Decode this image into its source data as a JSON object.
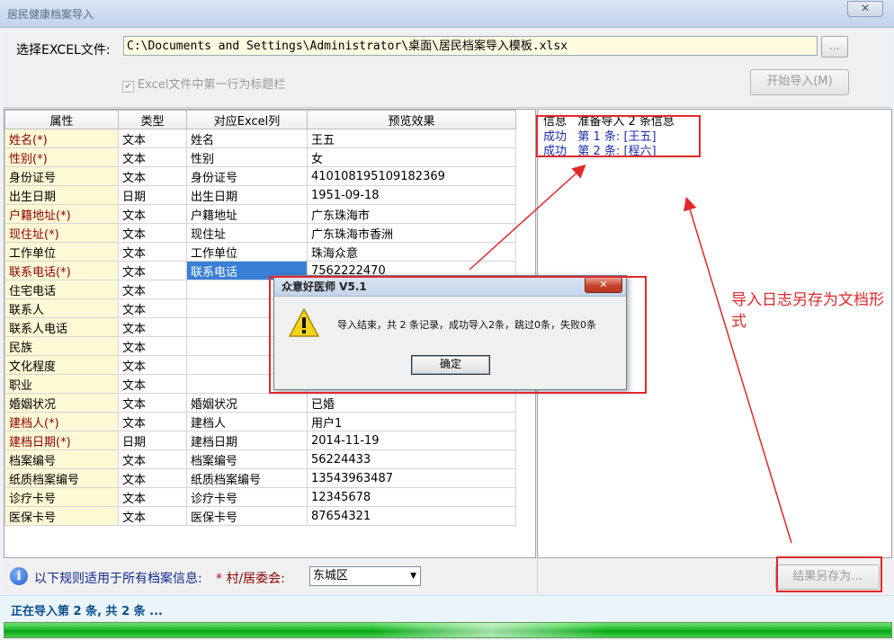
{
  "window": {
    "title": "居民健康档案导入",
    "close_glyph": "✕"
  },
  "top": {
    "file_label": "选择EXCEL文件:",
    "file_path": "C:\\Documents and Settings\\Administrator\\桌面\\居民档案导入模板.xlsx",
    "browse_label": "...",
    "header_checkbox_label": "Excel文件中第一行为标题栏",
    "header_checkbox_checked": true,
    "start_button": "开始导入(M)"
  },
  "grid": {
    "columns": [
      "属性",
      "类型",
      "对应Excel列",
      "预览效果"
    ],
    "rows": [
      {
        "attr": "姓名(*)",
        "type": "文本",
        "col": "姓名",
        "preview": "王五",
        "required": true
      },
      {
        "attr": "性别(*)",
        "type": "文本",
        "col": "性别",
        "preview": "女",
        "required": true
      },
      {
        "attr": "身份证号",
        "type": "文本",
        "col": "身份证号",
        "preview": "410108195109182369",
        "required": false
      },
      {
        "attr": "出生日期",
        "type": "日期",
        "col": "出生日期",
        "preview": "1951-09-18",
        "required": false
      },
      {
        "attr": "户籍地址(*)",
        "type": "文本",
        "col": "户籍地址",
        "preview": "广东珠海市",
        "required": true
      },
      {
        "attr": "现住址(*)",
        "type": "文本",
        "col": "现住址",
        "preview": "广东珠海市香洲",
        "required": true
      },
      {
        "attr": "工作单位",
        "type": "文本",
        "col": "工作单位",
        "preview": "珠海众意",
        "required": false
      },
      {
        "attr": "联系电话(*)",
        "type": "文本",
        "col": "联系电话",
        "preview": "7562222470",
        "required": true,
        "selected": true
      },
      {
        "attr": "住宅电话",
        "type": "文本",
        "col": "",
        "preview": "",
        "required": false
      },
      {
        "attr": "联系人",
        "type": "文本",
        "col": "",
        "preview": "",
        "required": false
      },
      {
        "attr": "联系人电话",
        "type": "文本",
        "col": "",
        "preview": "",
        "required": false
      },
      {
        "attr": "民族",
        "type": "文本",
        "col": "",
        "preview": "",
        "required": false
      },
      {
        "attr": "文化程度",
        "type": "文本",
        "col": "",
        "preview": "",
        "required": false
      },
      {
        "attr": "职业",
        "type": "文本",
        "col": "",
        "preview": "",
        "required": false
      },
      {
        "attr": "婚姻状况",
        "type": "文本",
        "col": "婚姻状况",
        "preview": "已婚",
        "required": false
      },
      {
        "attr": "建档人(*)",
        "type": "文本",
        "col": "建档人",
        "preview": "用户1",
        "required": true
      },
      {
        "attr": "建档日期(*)",
        "type": "日期",
        "col": "建档日期",
        "preview": "2014-11-19",
        "required": true
      },
      {
        "attr": "档案编号",
        "type": "文本",
        "col": "档案编号",
        "preview": "56224433",
        "required": false
      },
      {
        "attr": "纸质档案编号",
        "type": "文本",
        "col": "纸质档案编号",
        "preview": "13543963487",
        "required": false
      },
      {
        "attr": "诊疗卡号",
        "type": "文本",
        "col": "诊疗卡号",
        "preview": "12345678",
        "required": false
      },
      {
        "attr": "医保卡号",
        "type": "文本",
        "col": "医保卡号",
        "preview": "87654321",
        "required": false
      }
    ]
  },
  "log": {
    "header": "信息   准备导入 2 条信息",
    "lines": [
      "成功   第 1 条: [王五]",
      "成功   第 2 条: [程六]"
    ]
  },
  "bottom": {
    "info_icon_glyph": "i",
    "rule_text": "以下规则适用于所有档案信息:",
    "star": "*",
    "village_label": "村/居委会:",
    "village_value": "东城区",
    "dropdown_glyph": "▼",
    "save_button": "结果另存为..."
  },
  "status": {
    "text": "正在导入第 2 条, 共 2 条 ...",
    "progress_percent": 100
  },
  "dialog": {
    "title": "众意好医师 V5.1",
    "message": "导入结束，共 2 条记录，成功导入2条，跳过0条，失败0条",
    "ok_label": "确定",
    "close_glyph": "✕"
  },
  "annotation": {
    "text": "导入日志另存为文档形式",
    "color": "#e0282a"
  }
}
